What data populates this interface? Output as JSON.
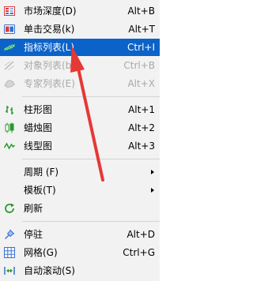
{
  "menu": {
    "items": [
      {
        "label": "市场深度(D)",
        "shortcut": "Alt+B",
        "icon": "market-depth-icon",
        "state": "normal"
      },
      {
        "label": "单击交易(k)",
        "shortcut": "Alt+T",
        "icon": "one-click-trading-icon",
        "state": "normal"
      },
      {
        "label": "指标列表(L)",
        "shortcut": "Ctrl+I",
        "icon": "indicators-list-icon",
        "state": "selected"
      },
      {
        "label": "对象列表(b)",
        "shortcut": "Ctrl+B",
        "icon": "objects-list-icon",
        "state": "disabled"
      },
      {
        "label": "专家列表(E)",
        "shortcut": "Alt+X",
        "icon": "experts-list-icon",
        "state": "disabled"
      },
      {
        "label": "柱形图",
        "shortcut": "Alt+1",
        "icon": "bar-chart-icon",
        "state": "normal"
      },
      {
        "label": "蜡烛图",
        "shortcut": "Alt+2",
        "icon": "candlestick-icon",
        "state": "normal"
      },
      {
        "label": "线型图",
        "shortcut": "Alt+3",
        "icon": "line-chart-icon",
        "state": "normal"
      },
      {
        "label": "周期 (F)",
        "shortcut": "",
        "icon": "",
        "state": "normal"
      },
      {
        "label": "模板(T)",
        "shortcut": "",
        "icon": "",
        "state": "normal"
      },
      {
        "label": "刷新",
        "shortcut": "",
        "icon": "refresh-icon",
        "state": "normal"
      },
      {
        "label": "停驻",
        "shortcut": "Alt+D",
        "icon": "pin-icon",
        "state": "normal"
      },
      {
        "label": "网格(G)",
        "shortcut": "Ctrl+G",
        "icon": "grid-icon",
        "state": "normal"
      },
      {
        "label": "自动滚动(S)",
        "shortcut": "",
        "icon": "auto-scroll-icon",
        "state": "normal"
      }
    ]
  },
  "colors": {
    "menu_background": "#f2f2f2",
    "selection": "#0b62c8",
    "annotation_arrow": "#e53935",
    "disabled_text": "#a8a8a8"
  }
}
